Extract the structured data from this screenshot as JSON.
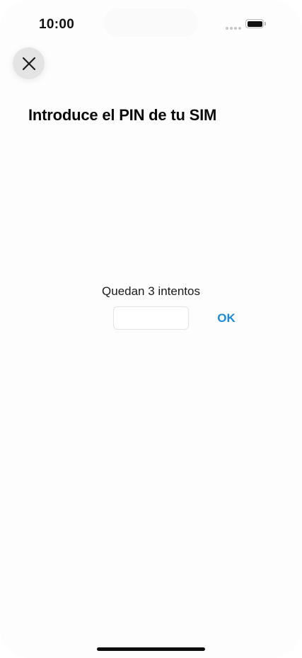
{
  "status_bar": {
    "time": "10:00"
  },
  "close_button": {
    "icon": "close-icon"
  },
  "title": "Introduce el PIN de tu SIM",
  "pin": {
    "attempts_text": "Quedan 3 intentos",
    "value": "",
    "placeholder": ""
  },
  "ok_button": {
    "label": "OK"
  },
  "colors": {
    "accent": "#1e88d4",
    "background": "#fdfdfd"
  }
}
